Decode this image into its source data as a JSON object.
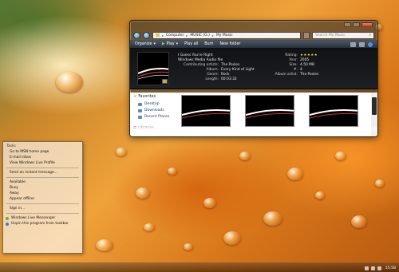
{
  "explorer": {
    "address": [
      "Computer",
      "MUSIC (G:)",
      "My Music"
    ],
    "search_placeholder": "Search My Music",
    "toolbar": {
      "organize": "Organize",
      "play": "Play",
      "play_all": "Play all",
      "burn": "Burn",
      "new_folder": "New folder"
    },
    "details": {
      "title": "I Guess You're Right",
      "file_type": "Windows Media Audio file",
      "contributing_artist_label": "Contributing artists:",
      "contributing_artist": "The Posies",
      "album_label": "Album:",
      "album": "Every Kind of Light",
      "genre_label": "Genre:",
      "genre": "Rock",
      "length_label": "Length:",
      "length": "00:03:32",
      "rating_label": "Rating:",
      "rating": 5,
      "year_label": "Year:",
      "year": "2005",
      "size_label": "Size:",
      "size": "4.50 MB",
      "track_label": "#:",
      "track": "4",
      "album_artist_label": "Album artist:",
      "album_artist": "The Posies"
    },
    "nav": {
      "favorites": "Favorites",
      "items": [
        "Desktop",
        "Downloads",
        "Recent Places"
      ],
      "libraries": "Libraries"
    }
  },
  "menu": {
    "title": "Tasks",
    "group1": [
      "Go to MSN home page",
      "E-mail inbox",
      "View Windows Live Profile"
    ],
    "group2": [
      "Send an instant message..."
    ],
    "group3": [
      "Available",
      "Busy",
      "Away",
      "Appear offline"
    ],
    "group4": [
      "Sign in..."
    ],
    "group5": [
      "Windows Live Messenger",
      "Unpin this program from taskbar"
    ]
  },
  "taskbar": {
    "clock": "15:58"
  },
  "colors": {
    "accent_star": "#ffcf3d",
    "link": "#1b3b66"
  }
}
